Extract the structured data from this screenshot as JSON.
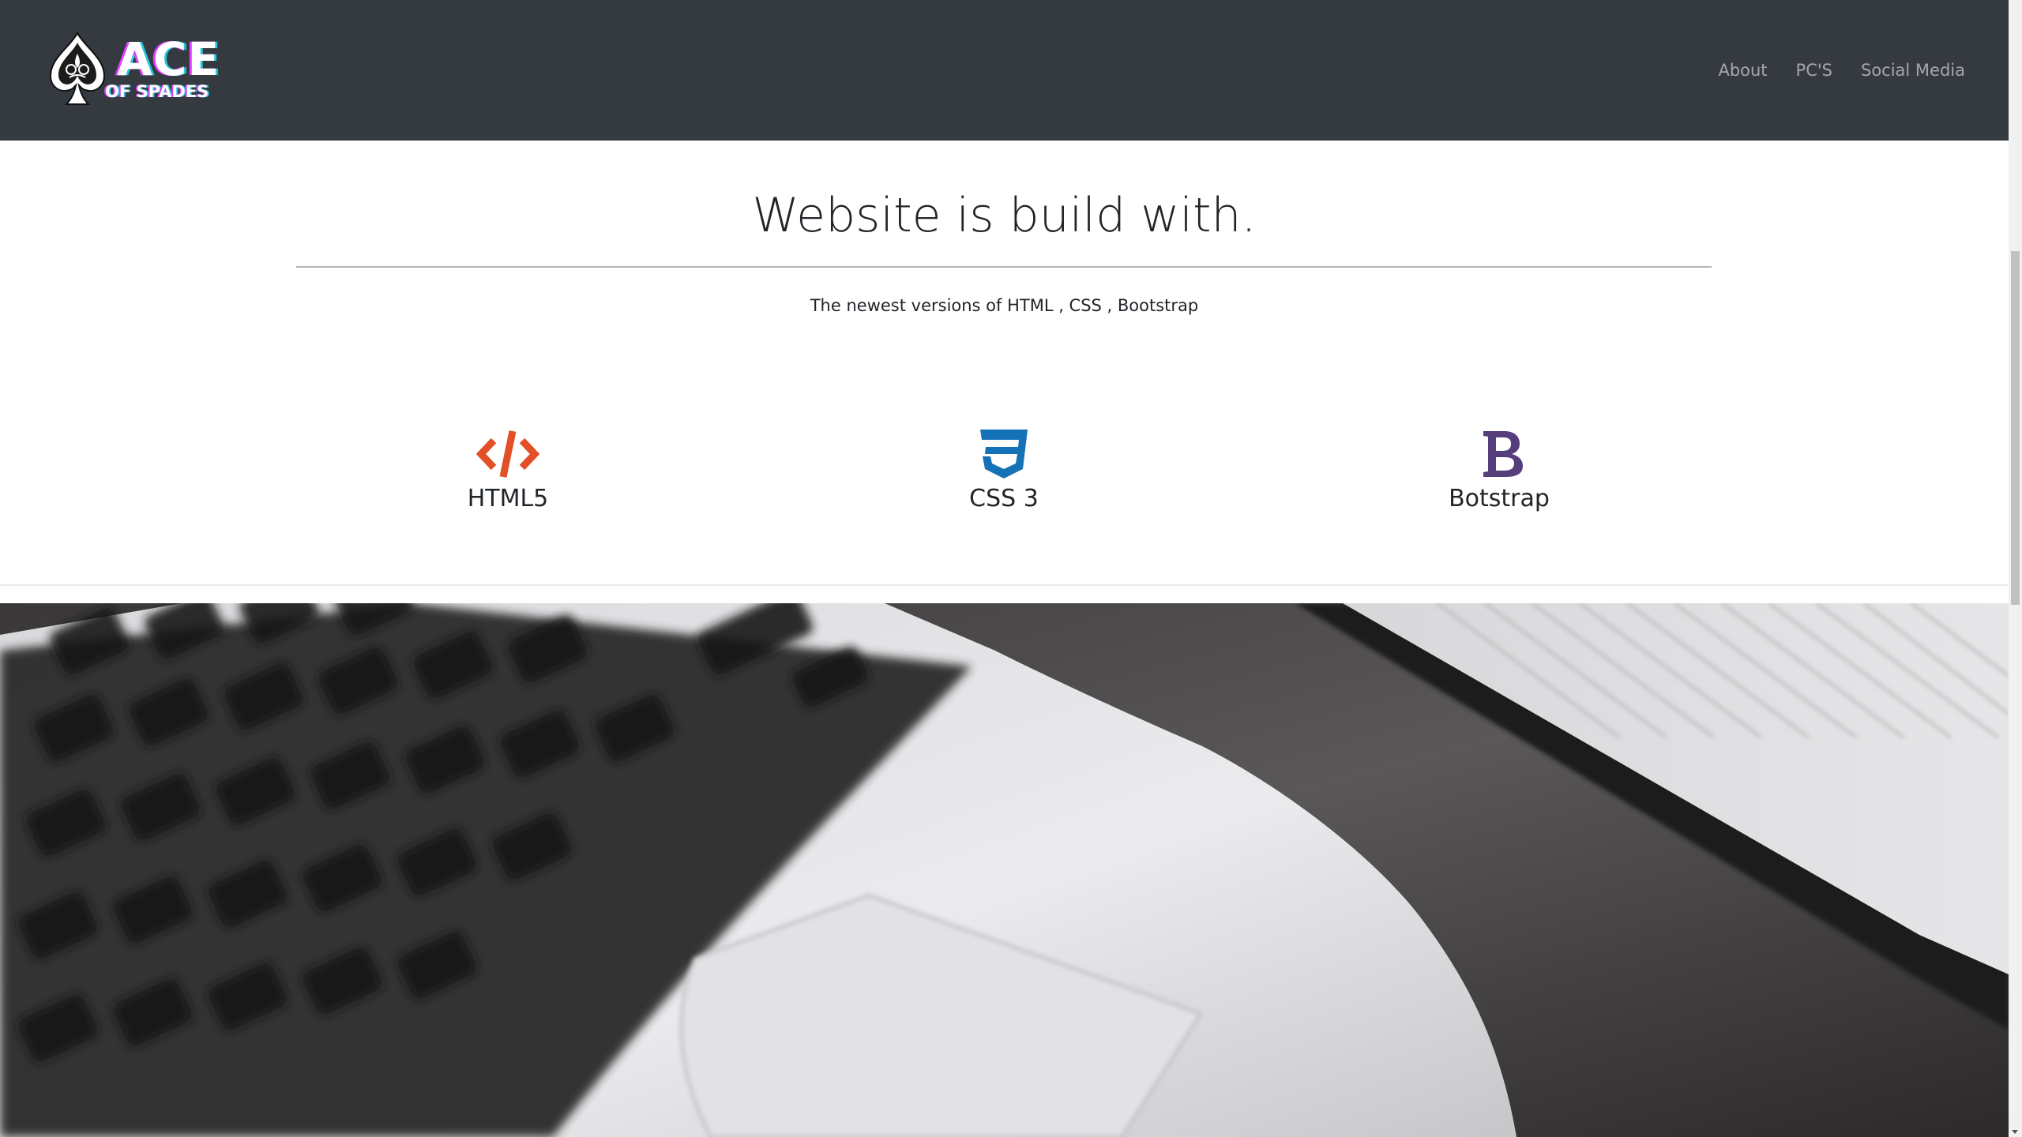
{
  "navbar": {
    "brand": {
      "title": "ACE",
      "subtitle": "OF SPADES",
      "logo_icon": "spade-icon"
    },
    "links": [
      {
        "label": "About"
      },
      {
        "label": "PC'S"
      },
      {
        "label": "Social Media"
      }
    ],
    "background_color": "#343a40"
  },
  "build_section": {
    "title": "Website is build with.",
    "subtitle": "The newest versions of HTML , CSS , Bootstrap",
    "technologies": [
      {
        "label": "HTML5",
        "icon": "html5-code-icon",
        "color": "#e34f26"
      },
      {
        "label": "CSS 3",
        "icon": "css3-icon",
        "color": "#1572b6"
      },
      {
        "label": "Botstrap",
        "icon": "bootstrap-icon",
        "color": "#563d7c"
      }
    ]
  },
  "hero": {
    "image": "laptop-keyboard-photo"
  }
}
